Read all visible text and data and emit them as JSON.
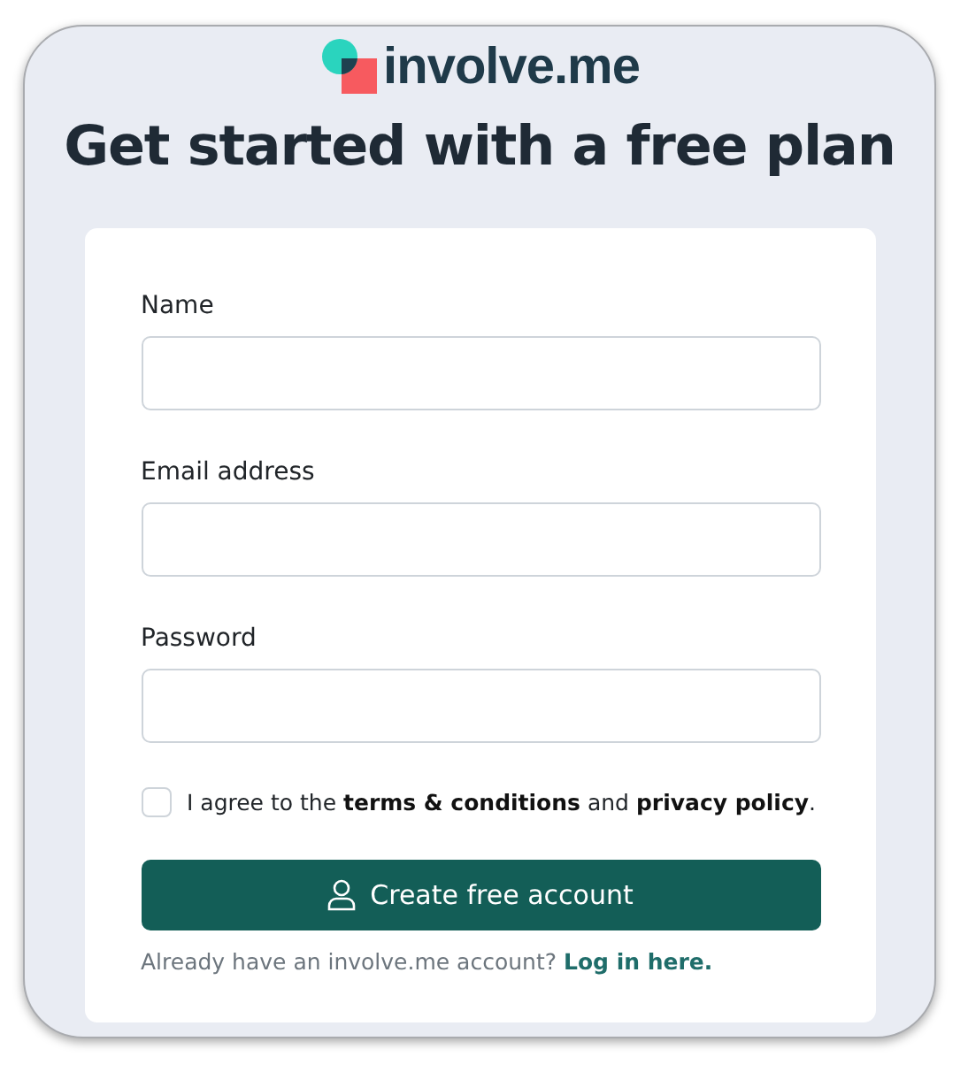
{
  "logo": {
    "text": "involve.me"
  },
  "heading": "Get started with a free plan",
  "fields": [
    {
      "label": "Name"
    },
    {
      "label": "Email address"
    },
    {
      "label": "Password"
    }
  ],
  "agreement": {
    "checked": false,
    "text": "I agree to the **terms & conditions** and **privacy policy**."
  },
  "submit": {
    "label": "Create free account"
  },
  "login": {
    "prompt": "Already have an involve.me account?",
    "link": "Log in here."
  }
}
